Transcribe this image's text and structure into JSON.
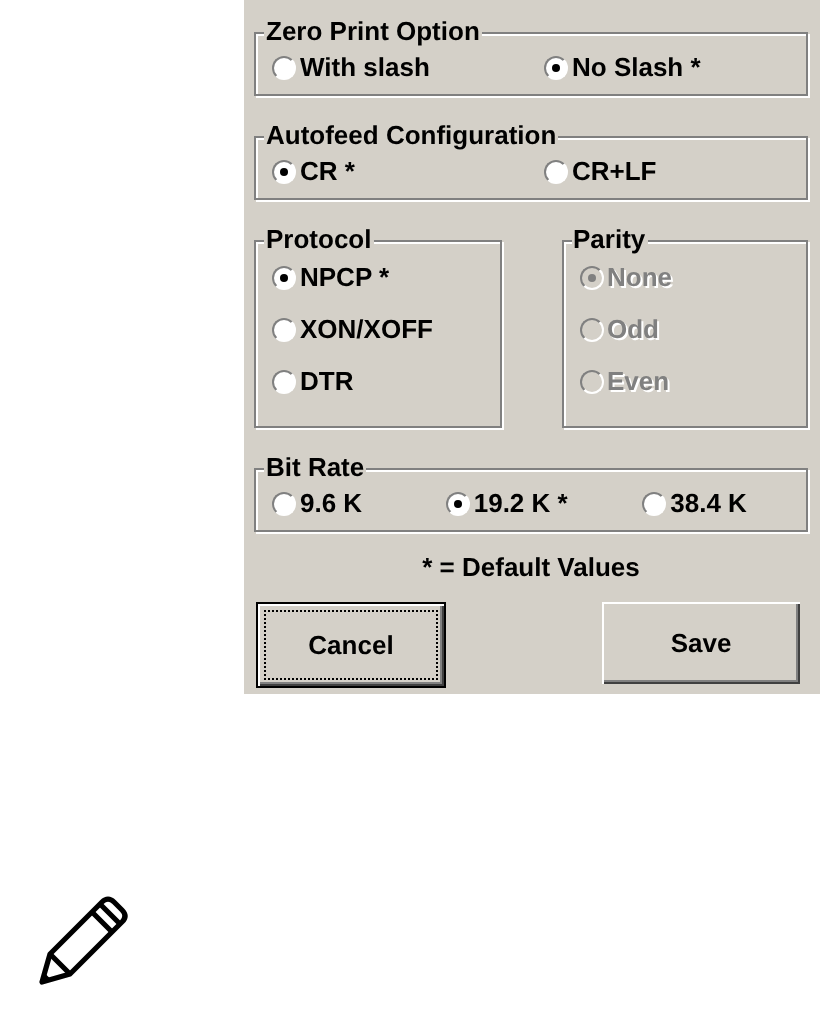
{
  "groups": [
    {
      "title": "Zero Print Option",
      "kind": "row",
      "disabled": false,
      "options": [
        {
          "label": "With slash",
          "selected": false
        },
        {
          "label": "No Slash *",
          "selected": true
        }
      ]
    },
    {
      "title": "Autofeed Configuration",
      "kind": "row",
      "disabled": false,
      "options": [
        {
          "label": "CR *",
          "selected": true
        },
        {
          "label": "CR+LF",
          "selected": false
        }
      ]
    },
    {
      "title": "Protocol",
      "kind": "column",
      "disabled": false,
      "options": [
        {
          "label": "NPCP *",
          "selected": true
        },
        {
          "label": "XON/XOFF",
          "selected": false
        },
        {
          "label": "DTR",
          "selected": false
        }
      ]
    },
    {
      "title": "Parity",
      "kind": "column",
      "disabled": true,
      "options": [
        {
          "label": "None",
          "selected": true
        },
        {
          "label": "Odd",
          "selected": false
        },
        {
          "label": "Even",
          "selected": false
        }
      ]
    },
    {
      "title": "Bit Rate",
      "kind": "row3",
      "disabled": false,
      "options": [
        {
          "label": "9.6 K",
          "selected": false
        },
        {
          "label": "19.2 K *",
          "selected": true
        },
        {
          "label": "38.4 K",
          "selected": false
        }
      ]
    }
  ],
  "note": "* = Default Values",
  "buttons": [
    {
      "label": "Cancel",
      "focused": true
    },
    {
      "label": "Save",
      "focused": false
    }
  ]
}
